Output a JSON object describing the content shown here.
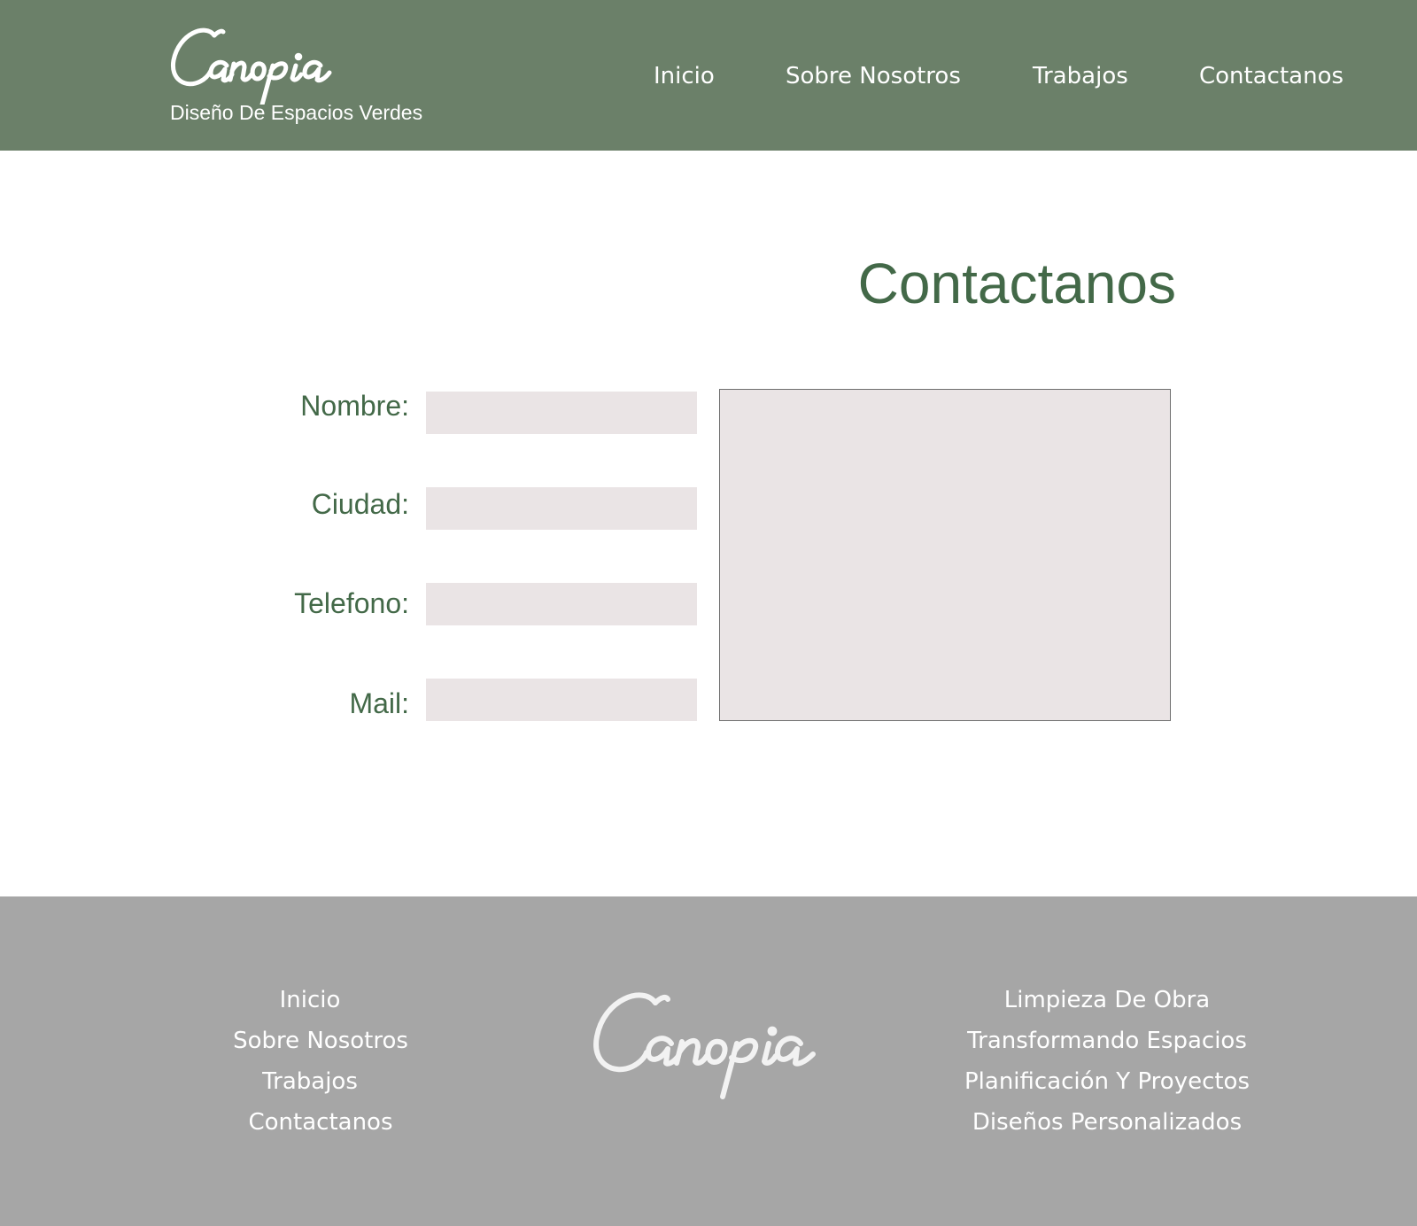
{
  "brand": {
    "logo_text": "Canopia",
    "tagline": "Diseño De Espacios Verdes"
  },
  "nav": {
    "items": [
      "Inicio",
      "Sobre Nosotros",
      "Trabajos",
      "Contactanos"
    ]
  },
  "main": {
    "title": "Contactanos",
    "fields": [
      {
        "label": "Nombre:",
        "value": ""
      },
      {
        "label": "Ciudad:",
        "value": ""
      },
      {
        "label": "Telefono:",
        "value": ""
      },
      {
        "label": "Mail:",
        "value": ""
      }
    ],
    "message": {
      "value": ""
    }
  },
  "footer": {
    "links_left": [
      "Inicio",
      "Sobre Nosotros",
      "Trabajos",
      "Contactanos"
    ],
    "logo_text": "Canopia",
    "links_right": [
      "Limpieza De Obra",
      "Transformando Espacios",
      "Planificación Y Proyectos",
      "Diseños Personalizados"
    ]
  },
  "colors": {
    "header_bg": "#6b8069",
    "accent_green": "#436948",
    "input_bg": "#eae4e5",
    "footer_bg": "#a6a6a6",
    "nav_text": "#ffffff"
  }
}
